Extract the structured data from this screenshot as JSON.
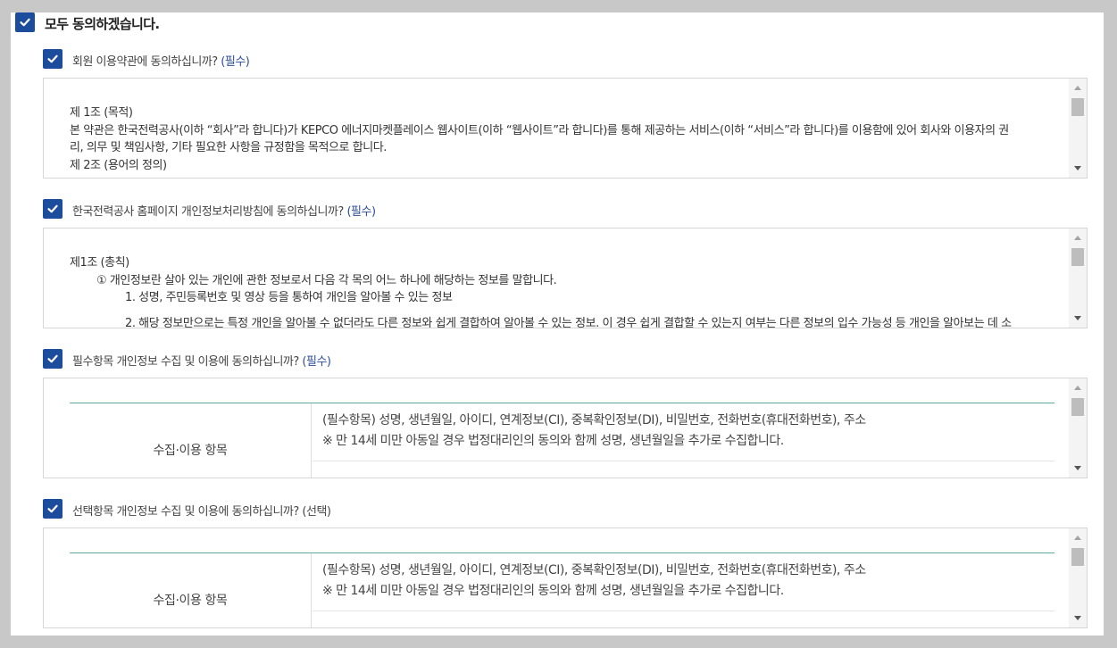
{
  "agree_all": {
    "label": "모두 동의하겠습니다.",
    "checked": true
  },
  "sections": [
    {
      "question": "회원 이용약관에 동의하십니까?",
      "tag": "(필수)",
      "lines": [
        "제 1조 (목적)",
        "본 약관은 한국전력공사(이하 “회사”라 합니다)가 KEPCO 에너지마켓플레이스 웹사이트(이하 “웹사이트”라 합니다)를 통해 제공하는 서비스(이하 “서비스”라 합니다)를 이용함에 있어 회사와 이용자의 권",
        "리, 의무 및 책임사항, 기타 필요한 사항을 규정함을 목적으로 합니다.",
        "제 2조 (용어의 정의)"
      ]
    },
    {
      "question": "한국전력공사 홈페이지 개인정보처리방침에 동의하십니까?",
      "tag": "(필수)",
      "lines": [
        "제1조  (총칙)",
        "① 개인정보란 살아 있는 개인에 관한 정보로서 다음 각 목의 어느 하나에 해당하는 정보를 말합니다.",
        "1. 성명, 주민등록번호 및 영상 등을 통하여 개인을 알아볼 수 있는 정보",
        "2. 해당 정보만으로는 특정 개인을 알아볼 수 없더라도 다른 정보와 쉽게 결합하여 알아볼 수 있는 정보. 이 경우 쉽게 결합할 수 있는지 여부는 다른 정보의 입수 가능성 등 개인을 알아보는 데 소"
      ]
    },
    {
      "question": "필수항목 개인정보 수집 및 이용에 동의하십니까?",
      "tag": "(필수)",
      "table": {
        "header": "수집·이용 항목",
        "line1": "(필수항목) 성명, 생년월일, 아이디, 연계정보(CI), 중복확인정보(DI), 비밀번호, 전화번호(휴대전화번호), 주소",
        "line2": "※ 만 14세 미만 아동일 경우 법정대리인의 동의와 함께 성명, 생년월일을 추가로 수집합니다."
      }
    },
    {
      "question": "선택항목 개인정보 수집 및 이용에 동의하십니까?",
      "tag": "(선택)",
      "table": {
        "header": "수집·이용 항목",
        "line1": "(필수항목) 성명, 생년월일, 아이디, 연계정보(CI), 중복확인정보(DI), 비밀번호, 전화번호(휴대전화번호), 주소",
        "line2": "※ 만 14세 미만 아동일 경우 법정대리인의 동의와 함께 성명, 생년월일을 추가로 수집합니다."
      }
    }
  ],
  "colors": {
    "checkbox": "#1c4d9c",
    "required_tag": "#2a4d9b",
    "table_rule": "#5fa8a4"
  },
  "icons": {
    "checkbox": "checkmark-icon",
    "scroll_up": "arrow-up-icon",
    "scroll_down": "arrow-down-icon"
  }
}
